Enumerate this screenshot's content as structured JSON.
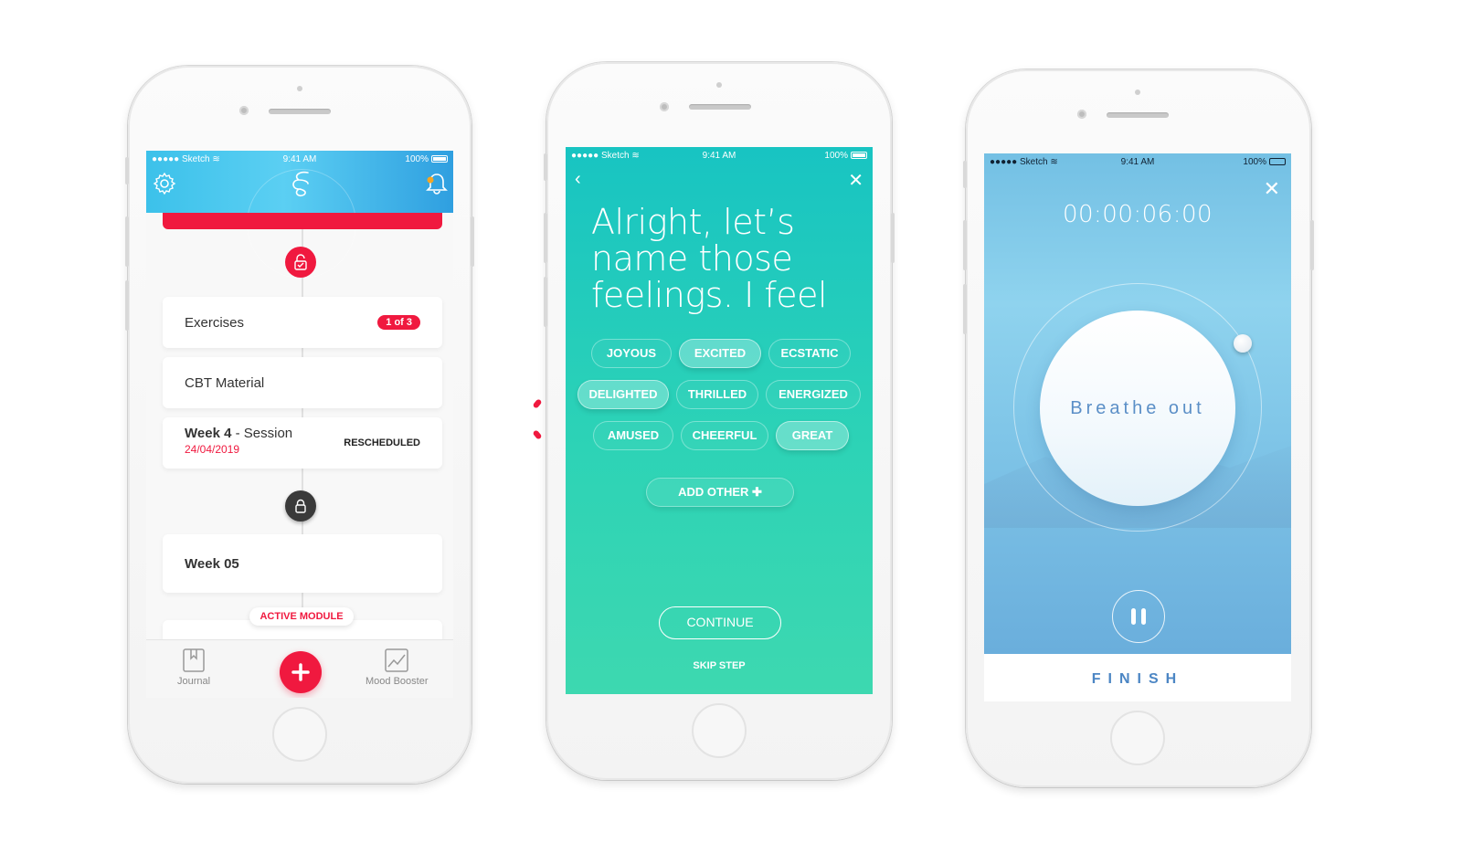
{
  "status_bar": {
    "carrier": "●●●●● Sketch",
    "wifi_icon": "wifi-icon",
    "time": "9:41 AM",
    "battery": "100%"
  },
  "phone1": {
    "header_icons": {
      "left": "gear-icon",
      "center": "app-logo-icon",
      "right": "bell-icon"
    },
    "items": [
      {
        "label": "Exercises",
        "badge": "1 of 3"
      },
      {
        "label": "CBT Material"
      },
      {
        "title_bold": "Week 4",
        "title_rest": " - Session",
        "date": "24/04/2019",
        "status": "RESCHEDULED"
      },
      {
        "label": "Week 05"
      }
    ],
    "active_module_label": "ACTIVE MODULE",
    "tabbar": {
      "journal_label": "Journal",
      "add_icon": "plus-icon",
      "mood_label": "Mood Booster"
    }
  },
  "phone2": {
    "back_icon": "chevron-left-icon",
    "close_icon": "close-icon",
    "headline": "Alright, let’s name those feelings. I feel",
    "feelings": [
      {
        "label": "JOYOUS",
        "selected": false
      },
      {
        "label": "EXCITED",
        "selected": true
      },
      {
        "label": "ECSTATIC",
        "selected": false
      },
      {
        "label": "DELIGHTED",
        "selected": true
      },
      {
        "label": "THRILLED",
        "selected": false
      },
      {
        "label": "ENERGIZED",
        "selected": false
      },
      {
        "label": "AMUSED",
        "selected": false
      },
      {
        "label": "CHEERFUL",
        "selected": false
      },
      {
        "label": "GREAT",
        "selected": true
      }
    ],
    "add_other_label": "ADD OTHER ✚",
    "continue_label": "CONTINUE",
    "skip_label": "SKIP STEP"
  },
  "phone3": {
    "timer": "00:00:06:00",
    "prompt": "Breathe out",
    "finish_label": "FINISH",
    "close_icon": "close-icon",
    "pause_icon": "pause-icon"
  },
  "colors": {
    "brand_red": "#f0193f",
    "teal": "#1fc8bf",
    "sky_blue": "#7cc4e6",
    "finish_blue": "#4c86c4"
  }
}
